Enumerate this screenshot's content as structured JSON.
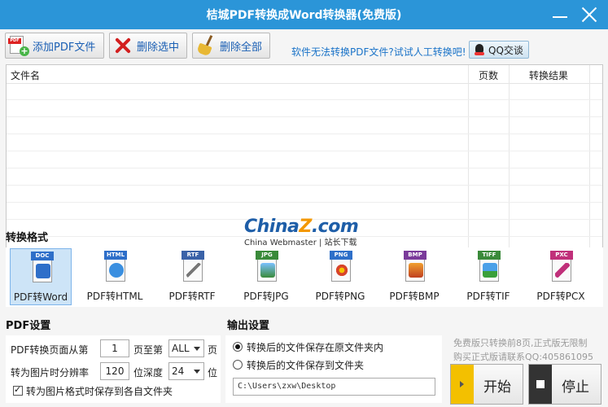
{
  "app": {
    "title": "桔城PDF转换成Word转换器(免费版)"
  },
  "toolbar": {
    "add_label": "添加PDF文件",
    "delete_label": "删除选中",
    "clear_label": "删除全部",
    "promo_text": "软件无法转换PDF文件?试试人工转换吧!",
    "qq_label": "QQ交谈"
  },
  "filelist": {
    "columns": [
      "文件名",
      "页数",
      "转换结果"
    ],
    "rows": []
  },
  "watermark": {
    "logo_a": "China",
    "logo_z": "Z",
    "logo_b": ".com",
    "sub": "China Webmaster | 站长下载"
  },
  "formats": {
    "title": "转换格式",
    "items": [
      {
        "label": "PDF转Word",
        "badge": "DOC",
        "color": "#2e6fc9",
        "icon": "word-doc-icon",
        "selected": true
      },
      {
        "label": "PDF转HTML",
        "badge": "HTML",
        "color": "#2e6fc9",
        "icon": "html-ie-icon",
        "selected": false
      },
      {
        "label": "PDF转RTF",
        "badge": "RTF",
        "color": "#3a62a8",
        "icon": "rtf-pen-icon",
        "selected": false
      },
      {
        "label": "PDF转JPG",
        "badge": "JPG",
        "color": "#3a8a3a",
        "icon": "jpg-image-icon",
        "selected": false
      },
      {
        "label": "PDF转PNG",
        "badge": "PNG",
        "color": "#2e6fc9",
        "icon": "png-flower-icon",
        "selected": false
      },
      {
        "label": "PDF转BMP",
        "badge": "BMP",
        "color": "#7a3a9a",
        "icon": "bmp-image-icon",
        "selected": false
      },
      {
        "label": "PDF转TIF",
        "badge": "TIFF",
        "color": "#3a8a3a",
        "icon": "tif-landscape-icon",
        "selected": false
      },
      {
        "label": "PDF转PCX",
        "badge": "PXC",
        "color": "#c0307a",
        "icon": "pcx-brush-icon",
        "selected": false
      }
    ]
  },
  "pdf_settings": {
    "title": "PDF设置",
    "range_label": "PDF转换页面从第",
    "from_page": "1",
    "to_label": "页至第",
    "to_page": "ALL",
    "page_suffix": "页",
    "dpi_label": "转为图片时分辨率",
    "dpi": "120",
    "depth_label": "位深度",
    "depth": "24",
    "bit_suffix": "位",
    "save_each_label": "转为图片格式时保存到各自文件夹",
    "save_each_checked": true
  },
  "output_settings": {
    "title": "输出设置",
    "option_original": "转换后的文件保存在原文件夹内",
    "option_folder": "转换后的文件保存到文件夹",
    "selected": "original",
    "path": "C:\\Users\\zxw\\Desktop"
  },
  "notes": {
    "line1": "免费版只转换前8页,正式版无限制",
    "line2": "购买正式版请联系QQ:405861095"
  },
  "actions": {
    "start_label": "开始",
    "stop_label": "停止"
  }
}
